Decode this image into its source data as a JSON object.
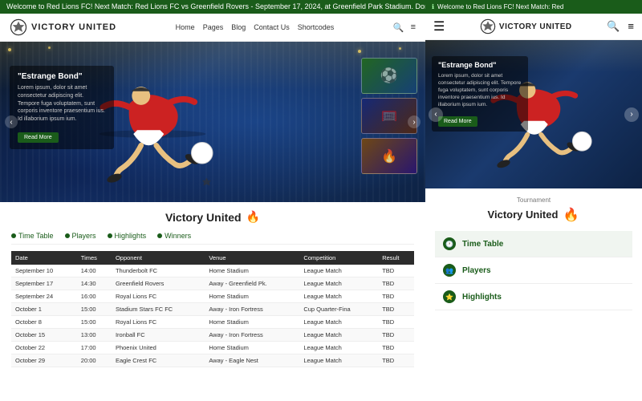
{
  "desktop": {
    "ticker": "Welcome to Red Lions FC! Next Match: Red Lions FC vs Greenfield Rovers - September 17, 2024, at Greenfield Park Stadium. Don't miss the action! 🏆 Welcome to Red Lions FC!",
    "logo": {
      "text": "VICTORY UNITED",
      "ball": "⚽"
    },
    "nav": {
      "links": [
        "Home",
        "Pages",
        "Blog",
        "Contact Us",
        "Shortcodes"
      ],
      "icons": [
        "🔍",
        "≡"
      ]
    },
    "hero": {
      "title": "\"Estrange Bond\"",
      "desc": "Lorem ipsum, dolor sit amet consectetur adipiscing elit. Tempore fuga voluptatem, sunt corporis inventore praesentium ius. Id illaborium ipsum ium.",
      "btn": "Read More",
      "arrow_left": "‹",
      "arrow_right": "›"
    },
    "section": {
      "title": "Victory United",
      "fire": "🔥",
      "tabs": [
        {
          "label": "Time Table",
          "icon": "clock"
        },
        {
          "label": "Players",
          "icon": "people"
        },
        {
          "label": "Highlights",
          "icon": "star"
        },
        {
          "label": "Winners",
          "icon": "trophy"
        }
      ],
      "table": {
        "headers": [
          "Date",
          "Times",
          "Opponent",
          "Venue",
          "Competition",
          "Result"
        ],
        "rows": [
          [
            "September 10",
            "14:00",
            "Thunderbolt FC",
            "Home Stadium",
            "League Match",
            "TBD"
          ],
          [
            "September 17",
            "14:30",
            "Greenfield Rovers",
            "Away - Greenfield Pk.",
            "League Match",
            "TBD"
          ],
          [
            "September 24",
            "16:00",
            "Royal Lions FC",
            "Home Stadium",
            "League Match",
            "TBD"
          ],
          [
            "October 1",
            "15:00",
            "Stadium Stars FC FC",
            "Away - Iron Fortress",
            "Cup Quarter-Fina",
            "TBD"
          ],
          [
            "October 8",
            "15:00",
            "Royal Lions FC",
            "Home Stadium",
            "League Match",
            "TBD"
          ],
          [
            "October 15",
            "13:00",
            "Ironball FC",
            "Away - Iron Fortress",
            "League Match",
            "TBD"
          ],
          [
            "October 22",
            "17:00",
            "Phoenix United",
            "Home Stadium",
            "League Match",
            "TBD"
          ],
          [
            "October 29",
            "20:00",
            "Eagle Crest FC",
            "Away - Eagle Nest",
            "League Match",
            "TBD"
          ]
        ]
      }
    }
  },
  "mobile": {
    "ticker": "Welcome to Red Lions FC! Next Match: Red",
    "logo": {
      "text": "VICTORY UNITED",
      "ball": "⚽"
    },
    "nav_icons": [
      "☰",
      "🔍",
      "≡"
    ],
    "hero": {
      "title": "\"Estrange Bond\"",
      "desc": "Lorem ipsum, dolor sit amet consectetur adipiscing elit. Tempore fuga voluptatem, sunt corporis inventore praesentium ius. Id illaborium ipsum ium.",
      "btn": "Read More",
      "arrow_left": "‹",
      "arrow_right": "›"
    },
    "tournament_label": "Tournament",
    "section_title": "Victory United",
    "fire": "🔥",
    "tabs": [
      {
        "label": "Time Table",
        "icon": "🕐",
        "active": true
      },
      {
        "label": "Players",
        "icon": "👥",
        "active": false
      },
      {
        "label": "Highlights",
        "icon": "⭐",
        "active": false
      }
    ]
  },
  "colors": {
    "green_dark": "#1a5c1a",
    "navy": "#0a1628",
    "table_header": "#2c2c2c"
  }
}
